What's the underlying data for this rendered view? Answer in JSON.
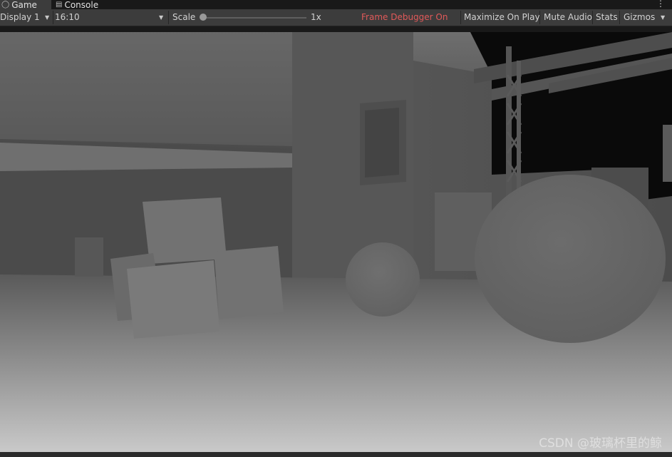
{
  "tabs": [
    {
      "label": "Game",
      "icon": "gamepad-icon",
      "active": true
    },
    {
      "label": "Console",
      "icon": "console-icon",
      "active": false
    }
  ],
  "toolbar": {
    "display": "Display 1",
    "aspect": "16:10",
    "scale_label": "Scale",
    "scale_value": "1x",
    "frame_debugger": "Frame Debugger On",
    "maximize": "Maximize On Play",
    "mute": "Mute Audio",
    "stats": "Stats",
    "gizmos": "Gizmos"
  },
  "scale_slider_level": 0,
  "watermark": "CSDN @玻璃杯里的鲸",
  "colors": {
    "frame_debugger": "#e05959",
    "toolbar_bg": "#3c3c3c",
    "tab_bg": "#191919"
  }
}
